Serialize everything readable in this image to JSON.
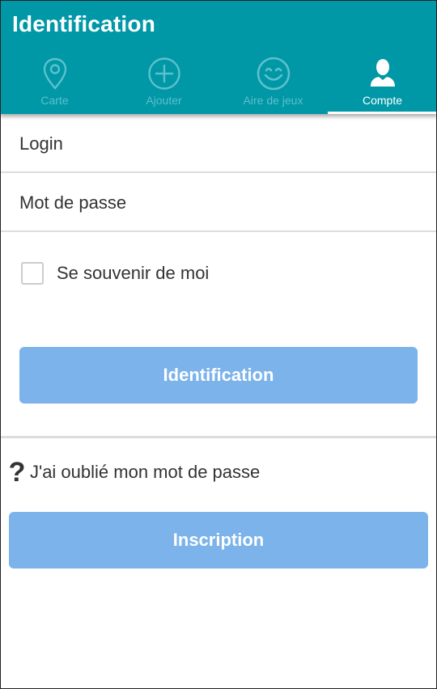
{
  "header": {
    "title": "Identification"
  },
  "tabs": [
    {
      "label": "Carte",
      "icon": "map-pin-icon",
      "active": false
    },
    {
      "label": "Ajouter",
      "icon": "plus-circle-icon",
      "active": false
    },
    {
      "label": "Aire de jeux",
      "icon": "smiley-icon",
      "active": false
    },
    {
      "label": "Compte",
      "icon": "user-icon",
      "active": true
    }
  ],
  "form": {
    "login_placeholder": "Login",
    "login_value": "",
    "password_placeholder": "Mot de passe",
    "password_value": "",
    "remember_label": "Se souvenir de moi",
    "remember_checked": false,
    "submit_label": "Identification"
  },
  "forgot": {
    "icon": "question-icon",
    "label": "J'ai oublié mon mot de passe"
  },
  "signup": {
    "label": "Inscription"
  },
  "colors": {
    "header": "#0097a7",
    "tab_inactive": "#5cc1cc",
    "tab_active": "#ffffff",
    "button": "#7bb3ea",
    "divider": "#dddddd"
  }
}
